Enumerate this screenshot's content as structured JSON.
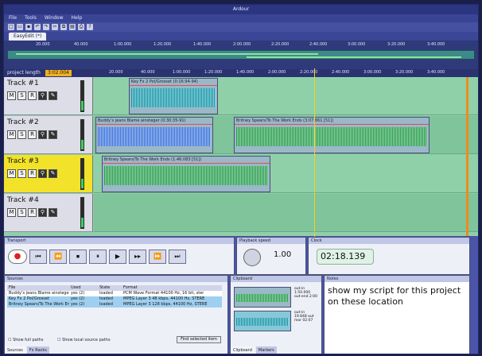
{
  "app": {
    "title": "Ardour"
  },
  "menu": [
    "File",
    "Tools",
    "Window",
    "Help"
  ],
  "toolbar_icons": [
    "new-icon",
    "open-icon",
    "save-icon",
    "undo-icon",
    "redo-icon",
    "cut-icon",
    "copy-icon",
    "paste-icon",
    "print-icon",
    "help-icon"
  ],
  "doc_tab": "EasyEdit (*)",
  "ruler_top": [
    "20.000",
    "40.000",
    "1:00.000",
    "1:20.000",
    "1:40.000",
    "2:00.000",
    "2:20.000",
    "2:40.000",
    "3:00.000",
    "3:20.000",
    "3:40.000"
  ],
  "project_length": {
    "label": "project length",
    "value": "3:02.004"
  },
  "ruler_main": [
    "20.000",
    "40.000",
    "1:00.000",
    "1:20.000",
    "1:40.000",
    "2:00.000",
    "2:20.000",
    "2:40.000",
    "3:00.000",
    "3:20.000",
    "3:40.000"
  ],
  "tracks": [
    {
      "name": "Track #1",
      "selected": false,
      "clips": [
        {
          "title": "Key Fx 2 Pol/Grosset (0:16:94-94)",
          "wave": "teal"
        }
      ]
    },
    {
      "name": "Track #2",
      "selected": false,
      "clips": [
        {
          "title": "Buddy’s jeans Blame ainsteger (0:30:35-91)",
          "wave": "blue"
        },
        {
          "title": "Britney Spears/To The Work Ends (3:07.861 [51])",
          "wave": "green"
        }
      ]
    },
    {
      "name": "Track #3",
      "selected": true,
      "clips": [
        {
          "title": "Britney Spears/To The Work Ends (1:46.083 [51])",
          "wave": "green"
        }
      ]
    },
    {
      "name": "Track #4",
      "selected": false,
      "clips": []
    }
  ],
  "track_buttons": {
    "mute": "M",
    "solo": "S",
    "record": "R"
  },
  "panels": {
    "transport_title": "Transport",
    "playback_speed_title": "Playback speed",
    "playback_speed_value": "1.00",
    "clock_title": "Clock",
    "clock_value": "02:18.139"
  },
  "transport": {
    "rewind_start": "⏮",
    "rewind": "⏪",
    "stop": "⏹",
    "pause": "⏸",
    "play": "▶",
    "play_loop": "▸▸",
    "forward": "⏩",
    "forward_end": "⏭"
  },
  "sources": {
    "title": "Sources",
    "columns": [
      "File",
      "Used",
      "State",
      "Format"
    ],
    "rows": [
      [
        "Buddy’s jeans Blame ainsteger",
        "yes (2)",
        "loaded",
        "PCM Wave Format 44100 Hz, 16 bit, ster"
      ],
      [
        "Key Fx 2 Pol/Grosset",
        "yes (2)",
        "loaded",
        "MPEG Layer 3 48 kbps, 44100 Hz, STERE"
      ],
      [
        "Britney Spears/To The Work Ends",
        "yes (2)",
        "loaded",
        "MPEG Layer 3 128 kbps, 44100 Hz, STERE"
      ]
    ],
    "show_full_paths": "Show full paths",
    "show_local_paths": "Show local source paths",
    "find_button": "Find selected item",
    "tabs": [
      "Sources",
      "Fx Racks"
    ]
  },
  "clipboard": {
    "title": "Clipboard",
    "items": [
      {
        "lines": [
          "out-in",
          "1:50.000",
          "out-end 2:00"
        ]
      },
      {
        "lines": [
          "out-in",
          "19.848 out",
          "mar 02:07"
        ]
      }
    ],
    "tabs": [
      "Clipboard",
      "Markers"
    ]
  },
  "notes": {
    "title": "Notes",
    "text": "show my script for this project on these location"
  },
  "colors": {
    "selected_track": "#f2e32a",
    "playhead": "#f4d020",
    "project_length_bg": "#f0b020",
    "clock_bg": "#dff2e6",
    "record": "#e02020"
  }
}
